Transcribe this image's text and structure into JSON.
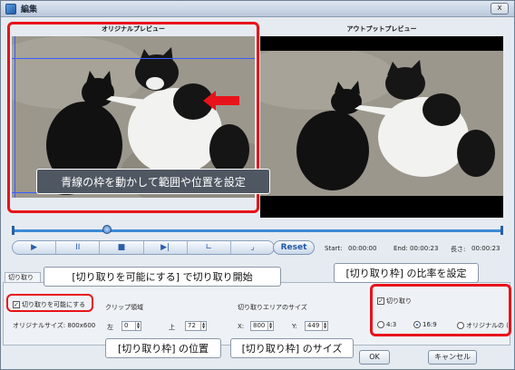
{
  "window": {
    "title": "編集",
    "close_glyph": "x"
  },
  "preview": {
    "original_label": "オリジナルプレビュー",
    "output_label": "アウトプットプレビュー"
  },
  "controls": {
    "play_glyph": "▶",
    "pause_glyph": "II",
    "stop_glyph": "■",
    "next_glyph": "▶|",
    "mark_in_glyph": "∟",
    "mark_out_glyph": "⌟",
    "reset_label": "Reset",
    "start_label": "Start:",
    "start_value": "00:00:00",
    "end_label": "End:",
    "end_value": "00:00:23",
    "length_label": "長さ:",
    "length_value": "00:00:23"
  },
  "panel": {
    "tab_label": "切り取り",
    "enable_crop_label": "切り取りを可能にする",
    "original_size_label": "オリジナルサイズ: 800x600",
    "crop_area_label": "クリップ領域",
    "left_label": "左",
    "left_value": "0",
    "top_label": "上",
    "top_value": "72",
    "crop_size_label": "切り取りエリアのサイズ",
    "x_label": "X:",
    "x_value": "800",
    "y_label": "Y:",
    "y_value": "449",
    "crop_check_label": "切り取り",
    "ratio_4_3": "4:3",
    "ratio_16_9": "16:9",
    "ratio_original": "オリジナルの (",
    "ok_label": "OK",
    "cancel_label": "キャンセル"
  },
  "callouts": {
    "move_frame": "青線の枠を動かして範囲や位置を設定",
    "enable_start": "[切り取りを可能にする] で切り取り開始",
    "ratio": "[切り取り枠] の比率を設定",
    "position": "[切り取り枠] の位置",
    "size": "[切り取り枠] のサイズ"
  },
  "colors": {
    "accent_red": "#e8131a",
    "crop_line_blue": "#3a5cff"
  }
}
